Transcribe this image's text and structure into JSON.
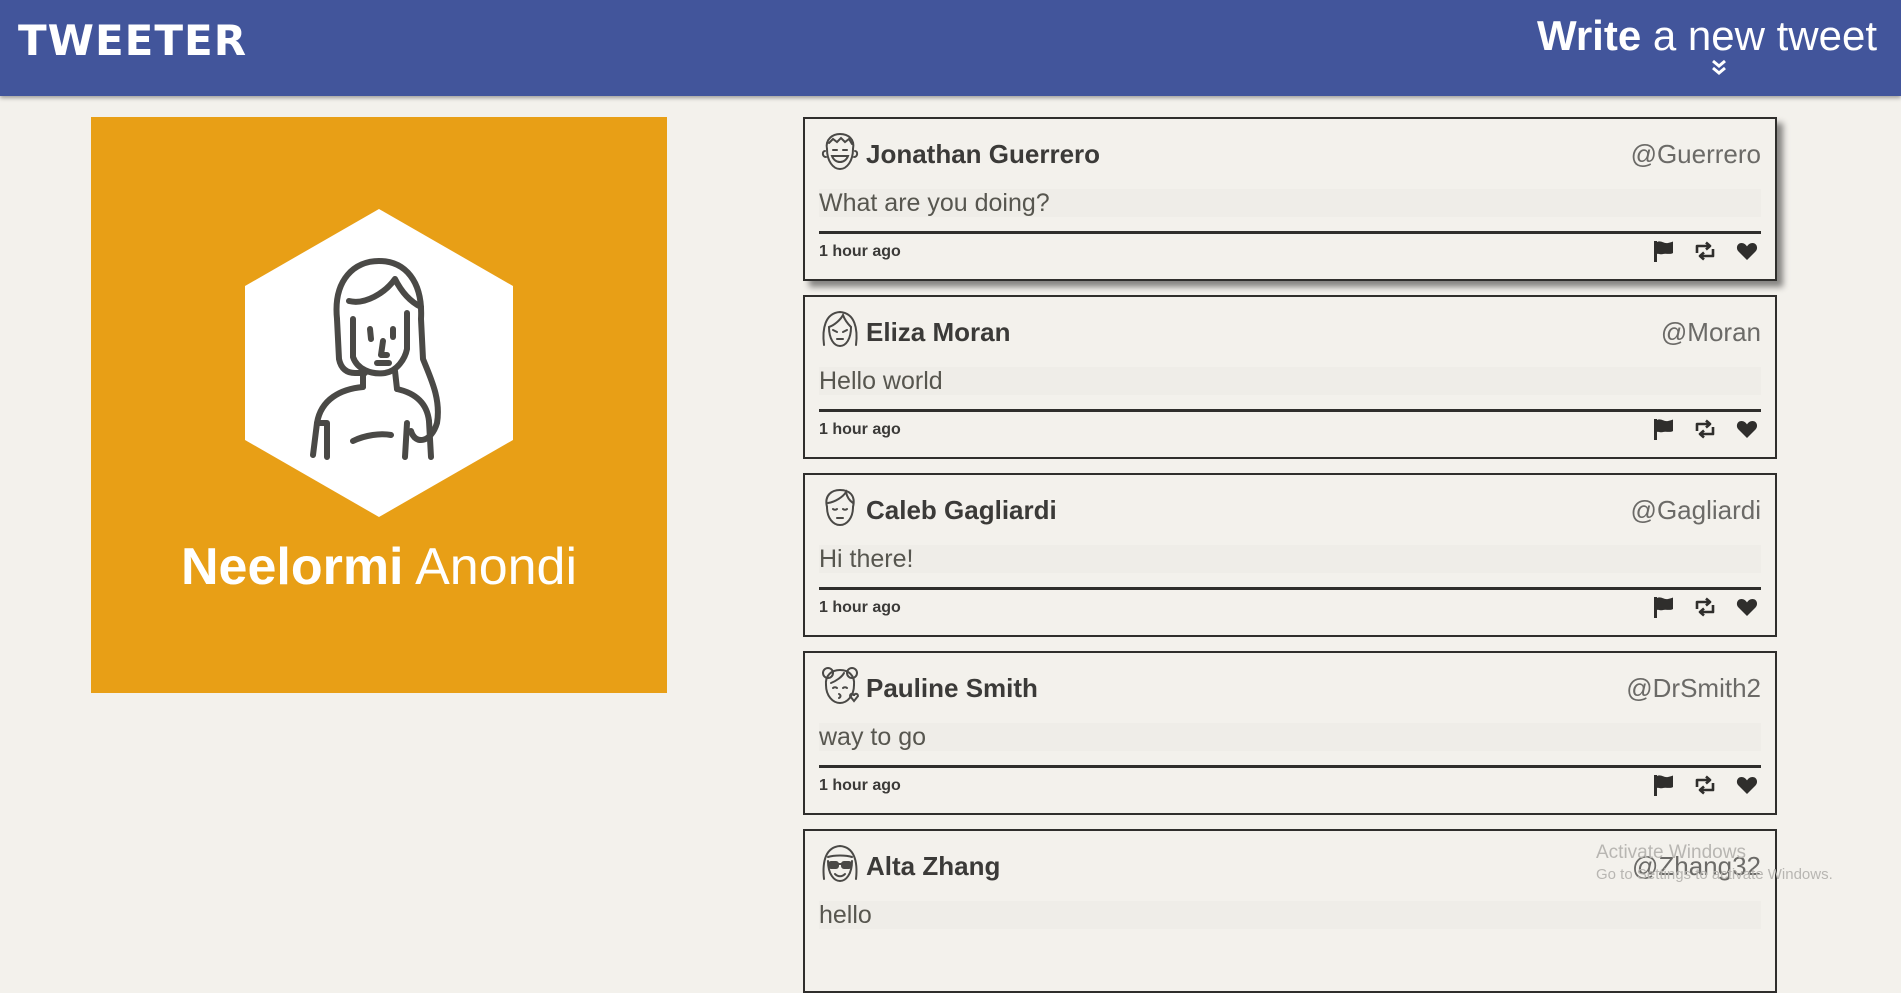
{
  "header": {
    "brand": "TWEETER",
    "compose_bold": "Write",
    "compose_rest": " a new tweet",
    "compose_icon": "double-chevron-down-icon",
    "background_color": "#42559b"
  },
  "profile": {
    "first_name": "Neelormi",
    "last_name": " Anondi",
    "avatar_icon": "female-avatar-hexagon-icon",
    "card_color": "#e89f16"
  },
  "tweets": [
    {
      "name": "Jonathan Guerrero",
      "handle": "@Guerrero",
      "text": "What are you doing?",
      "time": "1 hour ago",
      "avatar": "laughing-man-avatar-icon"
    },
    {
      "name": "Eliza Moran",
      "handle": "@Moran",
      "text": "Hello world",
      "time": "1 hour ago",
      "avatar": "girl-avatar-icon"
    },
    {
      "name": "Caleb Gagliardi",
      "handle": "@Gagliardi",
      "text": "Hi there!",
      "time": "1 hour ago",
      "avatar": "boy-avatar-icon"
    },
    {
      "name": "Pauline Smith",
      "handle": "@DrSmith2",
      "text": "way to go",
      "time": "1 hour ago",
      "avatar": "kissing-girl-avatar-icon"
    },
    {
      "name": "Alta Zhang",
      "handle": "@Zhang32",
      "text": "hello",
      "time": "",
      "avatar": "sunglasses-avatar-icon"
    }
  ],
  "tweet_actions": [
    "flag-icon",
    "retweet-icon",
    "heart-icon"
  ],
  "watermark": {
    "line1": "Activate Windows",
    "line2": "Go to Settings to activate Windows."
  }
}
